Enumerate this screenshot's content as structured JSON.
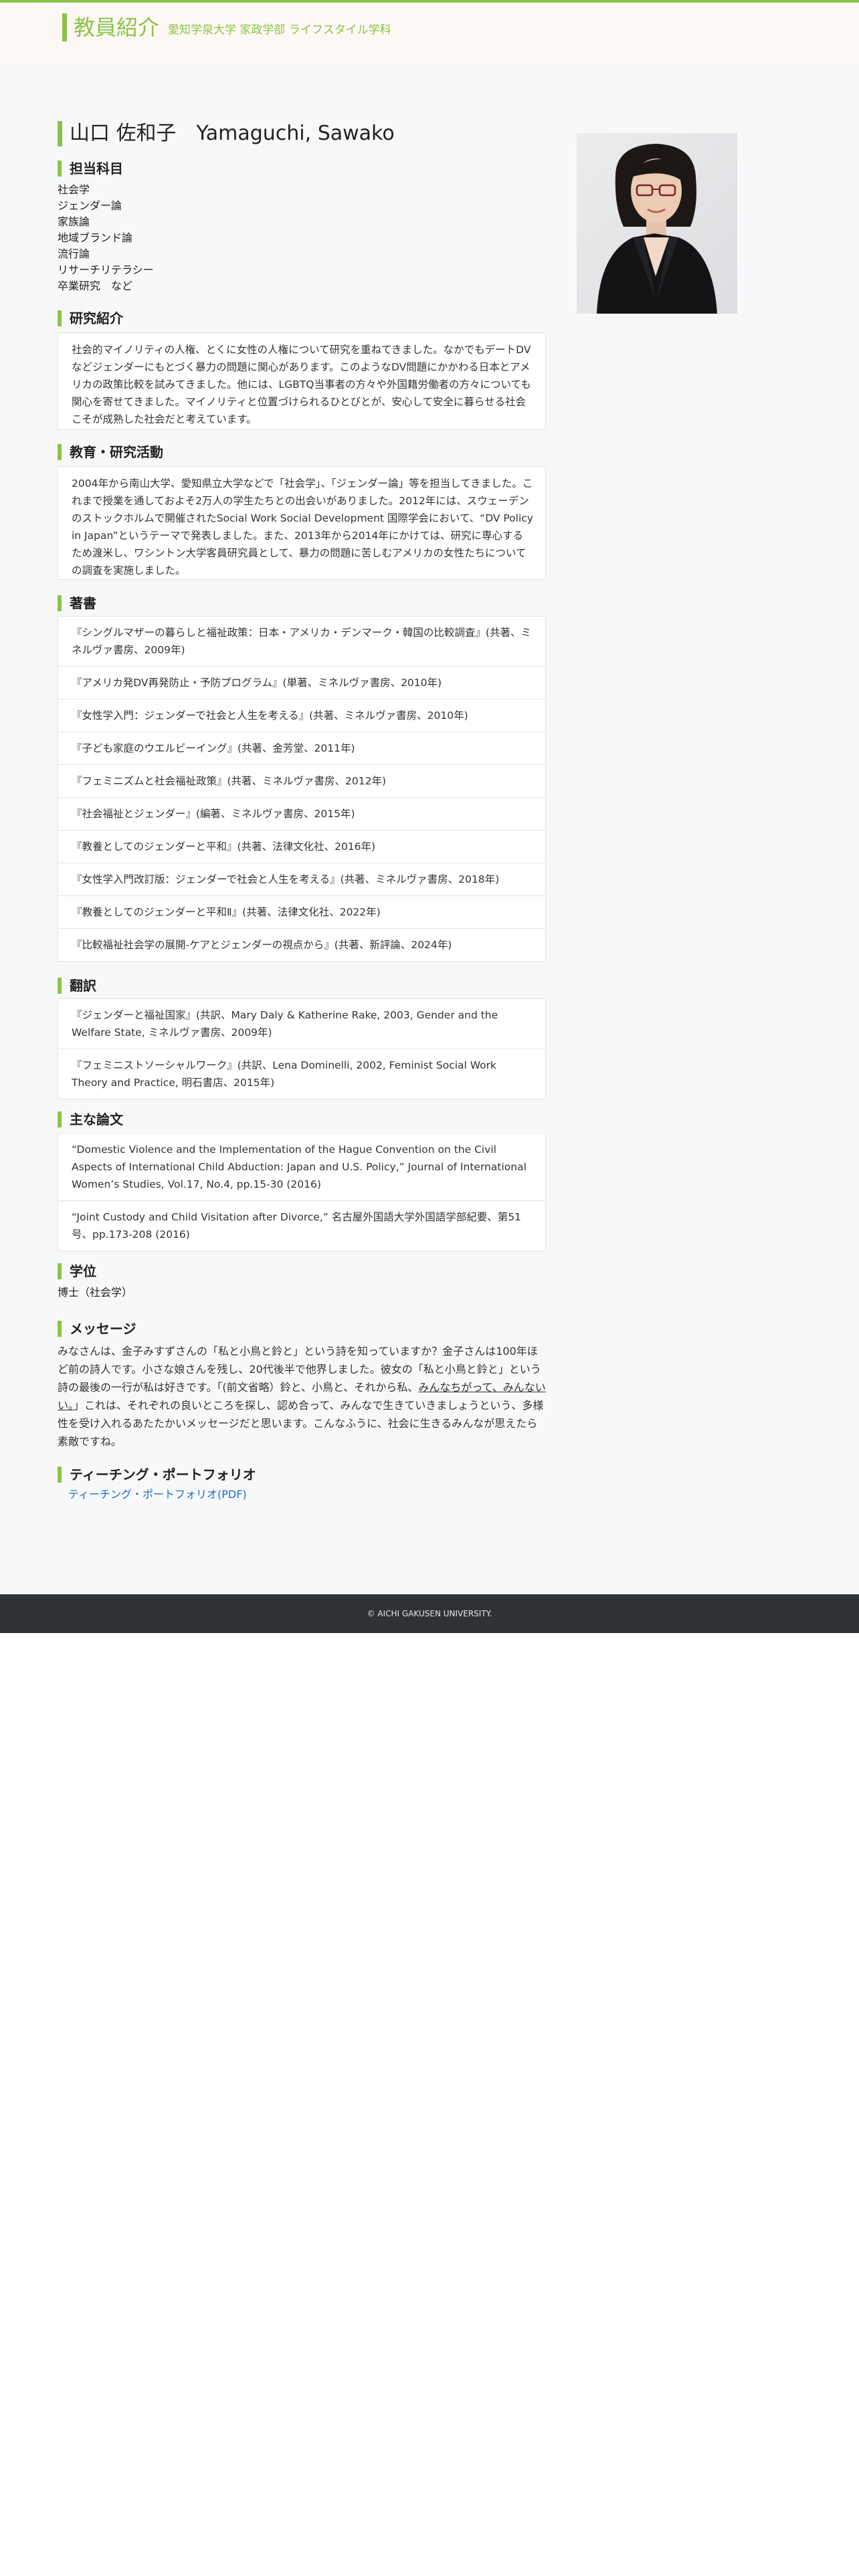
{
  "header": {
    "title": "教員紹介",
    "subtitle": "愛知学泉大学 家政学部 ライフスタイル学科"
  },
  "profile": {
    "name": "山口 佐和子　Yamaguchi, Sawako",
    "photo_icon": "portrait-photo"
  },
  "subjects": {
    "title": "担当科目",
    "items": [
      "社会学",
      "ジェンダー論",
      "家族論",
      "地域ブランド論",
      "流行論",
      "リサーチリテラシー",
      "卒業研究　など"
    ]
  },
  "research": {
    "title": "研究紹介",
    "text": "社会的マイノリティの人権、とくに女性の人権について研究を重ねてきました。なかでもデートDVなどジェンダーにもとづく暴力の問題に関心があります。このようなDV問題にかかわる日本とアメリカの政策比較を試みてきました。他には、LGBTQ当事者の方々や外国籍労働者の方々についても関心を寄せてきました。マイノリティと位置づけられるひとびとが、安心して安全に暮らせる社会こそが成熟した社会だと考えています。"
  },
  "education": {
    "title": "教育・研究活動",
    "text": "2004年から南山大学、愛知県立大学などで「社会学」、「ジェンダー論」等を担当してきました。これまで授業を通しておよそ2万人の学生たちとの出会いがありました。2012年には、スウェーデンのストックホルムで開催されたSocial Work Social Development 国際学会において、“DV Policy in Japan”というテーマで発表しました。また、2013年から2014年にかけては、研究に専心するため渡米し、ワシントン大学客員研究員として、暴力の問題に苦しむアメリカの女性たちについての調査を実施しました。"
  },
  "books": {
    "title": "著書",
    "items": [
      "『シングルマザーの暮らしと福祉政策：日本・アメリカ・デンマーク・韓国の比較調査』(共著、ミネルヴァ書房、2009年)",
      "『アメリカ発DV再発防止・予防プログラム』(単著、ミネルヴァ書房、2010年)",
      "『女性学入門：ジェンダーで社会と人生を考える』(共著、ミネルヴァ書房、2010年)",
      "『子ども家庭のウエルビーイング』(共著、金芳堂、2011年)",
      "『フェミニズムと社会福祉政策』(共著、ミネルヴァ書房、2012年)",
      "『社会福祉とジェンダー』(編著、ミネルヴァ書房、2015年)",
      "『教養としてのジェンダーと平和』(共著、法律文化社、2016年)",
      "『女性学入門改訂版：ジェンダーで社会と人生を考える』(共著、ミネルヴァ書房、2018年)",
      "『教養としてのジェンダーと平和Ⅱ』(共著、法律文化社、2022年)",
      "『比較福祉社会学の展開-ケアとジェンダーの視点から』(共著、新評論、2024年)"
    ]
  },
  "translations": {
    "title": "翻訳",
    "items": [
      "『ジェンダーと福祉国家』(共訳、Mary Daly & Katherine Rake, 2003, Gender and the Welfare State, ミネルヴァ書房、2009年)",
      "『フェミニストソーシャルワーク』(共訳、Lena Dominelli, 2002, Feminist Social Work Theory and Practice, 明石書店、2015年)"
    ]
  },
  "papers": {
    "title": "主な論文",
    "items": [
      "“Domestic Violence and the Implementation of the Hague Convention on the Civil Aspects of International Child Abduction: Japan and U.S. Policy,” Journal of International Women’s Studies, Vol.17, No.4, pp.15-30 (2016)",
      "“Joint Custody and Child Visitation after Divorce,” 名古屋外国語大学外国語学部紀要、第51号、pp.173-208 (2016)"
    ]
  },
  "degree": {
    "title": "学位",
    "text": "博士（社会学）"
  },
  "message": {
    "title": "メッセージ",
    "text_before": "みなさんは、金子みすずさんの「私と小鳥と鈴と」という詩を知っていますか？金子さんは100年ほど前の詩人です。小さな娘さんを残し、20代後半で他界しました。彼女の「私と小鳥と鈴と」という詩の最後の一行が私は好きです。「(前文省略）鈴と、小鳥と、それから私、",
    "text_underlined": "みんなちがって、みんないい。",
    "text_after": "」これは、それぞれの良いところを探し、認め合って、みんなで生きていきましょうという、多様性を受け入れるあたたかいメッセージだと思います。こんなふうに、社会に生きるみんなが思えたら素敵ですね。"
  },
  "portfolio": {
    "title": "ティーチング・ポートフォリオ",
    "link_label": "ティーチング・ポートフォリオ(PDF)"
  },
  "footer": {
    "copyright": "© AICHI GAKUSEN UNIVERSITY."
  }
}
